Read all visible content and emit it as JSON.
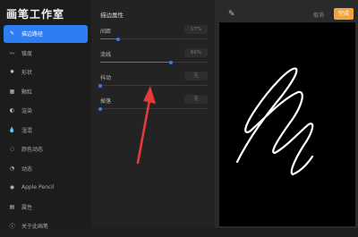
{
  "app": {
    "title": "画笔工作室"
  },
  "sidebar": {
    "items": [
      {
        "label": "描边路径",
        "icon": "stroke-path-icon",
        "glyph": "✎",
        "active": true
      },
      {
        "label": "锥度",
        "icon": "taper-icon",
        "glyph": "〰",
        "active": false
      },
      {
        "label": "形状",
        "icon": "shape-icon",
        "glyph": "✹",
        "active": false
      },
      {
        "label": "颗粒",
        "icon": "grain-icon",
        "glyph": "▦",
        "active": false
      },
      {
        "label": "渲染",
        "icon": "render-icon",
        "glyph": "◐",
        "active": false
      },
      {
        "label": "湿混",
        "icon": "wet-mix-icon",
        "glyph": "💧",
        "active": false
      },
      {
        "label": "颜色动态",
        "icon": "color-dynamics-icon",
        "glyph": "◌",
        "active": false
      },
      {
        "label": "动态",
        "icon": "dynamics-icon",
        "glyph": "◔",
        "active": false
      },
      {
        "label": "Apple Pencil",
        "icon": "pencil-icon",
        "glyph": "◉",
        "active": false
      },
      {
        "label": "属性",
        "icon": "properties-icon",
        "glyph": "▤",
        "active": false
      },
      {
        "label": "关于此画笔",
        "icon": "info-icon",
        "glyph": "ⓘ",
        "active": false
      }
    ]
  },
  "panel": {
    "title": "描边属性",
    "settings": [
      {
        "label": "间距",
        "value": "17%",
        "level": 0.17
      },
      {
        "label": "流线",
        "value": "66%",
        "level": 0.66
      },
      {
        "label": "抖动",
        "value": "无",
        "level": 0
      },
      {
        "label": "掉落",
        "value": "无",
        "level": 0
      }
    ]
  },
  "canvas": {
    "cancel_label": "取消",
    "done_label": "完成",
    "edit_icon": "edit-icon"
  },
  "colors": {
    "accent": "#2f7df3",
    "done": "#f2a33a",
    "annotation_arrow": "#e23b3b"
  }
}
